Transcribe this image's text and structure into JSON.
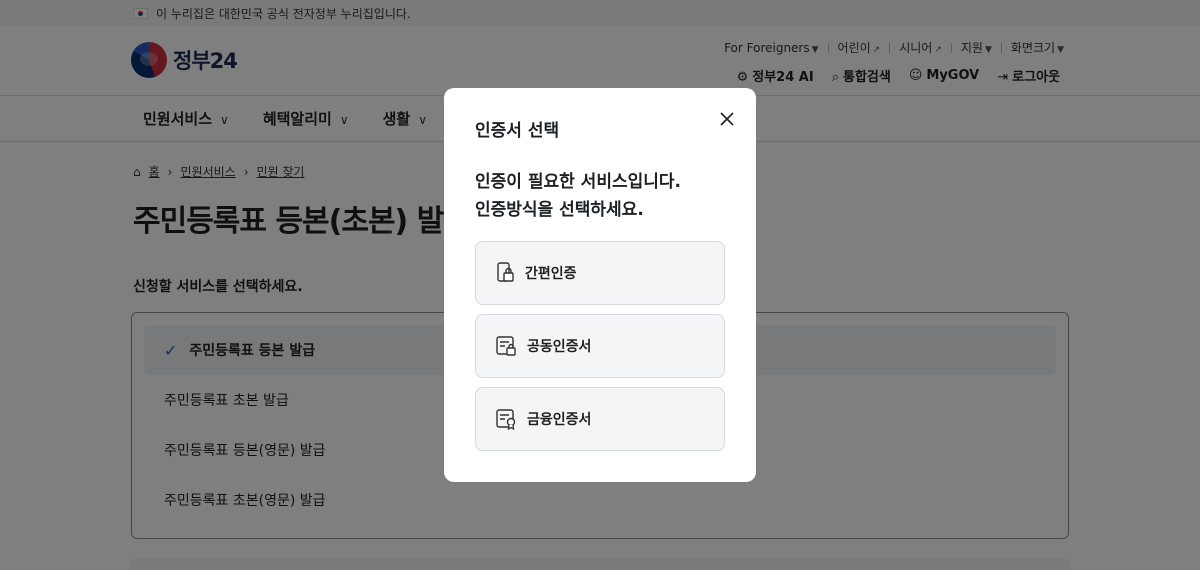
{
  "gov_banner": {
    "text": "이 누리집은 대한민국 공식 전자정부 누리집입니다."
  },
  "logo": {
    "text": "정부",
    "number": "24"
  },
  "utility_links": {
    "foreigners": "For Foreigners",
    "kids": "어린이",
    "seniors": "시니어",
    "support": "지원",
    "screen_size": "화면크기"
  },
  "main_links": {
    "ai": "정부24 AI",
    "search": "통합검색",
    "mygov": "MyGOV",
    "logout": "로그아웃"
  },
  "gnb": {
    "items": [
      {
        "label": "민원서비스"
      },
      {
        "label": "혜택알리미"
      },
      {
        "label": "생활"
      }
    ]
  },
  "breadcrumb": {
    "home": "홈",
    "level1": "민원서비스",
    "level2": "민원 찾기"
  },
  "page": {
    "title": "주민등록표 등본(초본) 발급",
    "sub_heading": "신청할 서비스를 선택하세요."
  },
  "services": [
    {
      "label": "주민등록표 등본 발급",
      "selected": true
    },
    {
      "label": "주민등록표 초본 발급"
    },
    {
      "label": "주민등록표 등본(영문) 발급"
    },
    {
      "label": "주민등록표 초본(영문) 발급"
    }
  ],
  "modal": {
    "title": "인증서 선택",
    "message_line1": "인증이 필요한 서비스입니다.",
    "message_line2": "인증방식을 선택하세요.",
    "options": [
      {
        "label": "간편인증",
        "icon": "phone-lock-icon"
      },
      {
        "label": "공동인증서",
        "icon": "certificate-lock-icon"
      },
      {
        "label": "금융인증서",
        "icon": "certificate-badge-icon"
      }
    ],
    "close_icon": "close-icon"
  }
}
